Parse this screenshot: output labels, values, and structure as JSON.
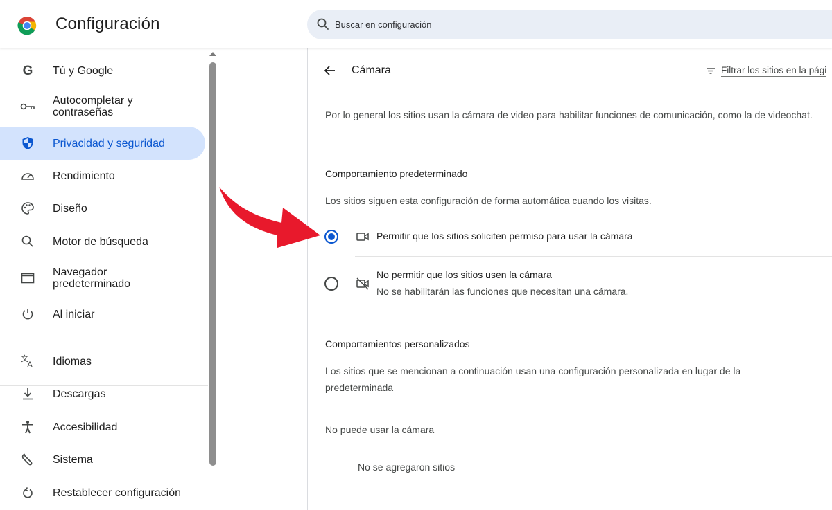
{
  "header": {
    "title": "Configuración",
    "search_placeholder": "Buscar en configuración",
    "logo": "chrome-logo-icon"
  },
  "sidebar": {
    "items": [
      {
        "label": "Tú y Google",
        "icon": "google-g-icon"
      },
      {
        "label": "Autocompletar y contraseñas",
        "icon": "key-icon"
      },
      {
        "label": "Privacidad y seguridad",
        "icon": "shield-icon",
        "active": true
      },
      {
        "label": "Rendimiento",
        "icon": "speedometer-icon"
      },
      {
        "label": "Diseño",
        "icon": "palette-icon"
      },
      {
        "label": "Motor de búsqueda",
        "icon": "search-icon"
      },
      {
        "label": "Navegador predeterminado",
        "icon": "browser-window-icon"
      },
      {
        "label": "Al iniciar",
        "icon": "power-icon"
      },
      {
        "label": "Idiomas",
        "icon": "translate-icon"
      },
      {
        "label": "Descargas",
        "icon": "download-icon"
      },
      {
        "label": "Accesibilidad",
        "icon": "accessibility-icon"
      },
      {
        "label": "Sistema",
        "icon": "wrench-icon"
      },
      {
        "label": "Restablecer configuración",
        "icon": "reset-icon"
      }
    ]
  },
  "main": {
    "page_title": "Cámara",
    "filter_label": "Filtrar los sitios en la pági",
    "description": "Por lo general los sitios usan la cámara de video para habilitar funciones de comunicación, como la de videochat.",
    "default_heading": "Comportamiento predeterminado",
    "default_text": "Los sitios siguen esta configuración de forma automática cuando los visitas.",
    "options": [
      {
        "label": "Permitir que los sitios soliciten permiso para usar la cámara",
        "icon": "camera-icon",
        "checked": true
      },
      {
        "label": "No permitir que los sitios usen la cámara",
        "sub": "No se habilitarán las funciones que necesitan una cámara.",
        "icon": "camera-off-icon",
        "checked": false
      }
    ],
    "custom_heading": "Comportamientos personalizados",
    "custom_text": "Los sitios que se mencionan a continuación usan una configuración personalizada en lugar de la predeterminada",
    "blocked_heading": "No puede usar la cámara",
    "blocked_empty": "No se agregaron sitios"
  },
  "colors": {
    "accent": "#0b57d0",
    "active_bg": "#d3e3fd",
    "annotation_arrow": "#e8192c"
  }
}
